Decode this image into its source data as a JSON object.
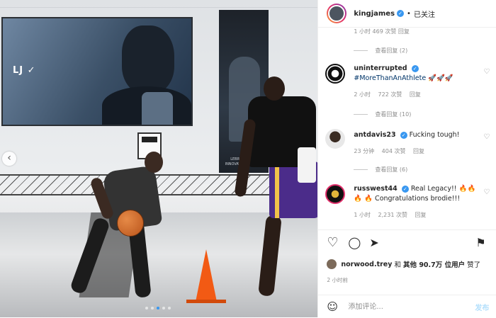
{
  "post_header": {
    "username": "kingjames",
    "verified_glyph": "✓",
    "separator": "•",
    "follow_label": "已关注"
  },
  "photo_overlay": {
    "screen_logo": "LJ  ✓",
    "banner_caption": "LEBRON JAMES INNOVATION CENTER",
    "carousel_prev": "‹"
  },
  "comments": {
    "cut_meta": "1 小时   469 次赞   回复",
    "thread_1_replies": "查看回复 (2)",
    "items": [
      {
        "username": "uninterrupted",
        "verified": true,
        "text": "#MoreThanAnAthlete 🚀🚀🚀",
        "time": "2 小时",
        "likes": "722 次赞",
        "reply": "回复",
        "view_replies": "查看回复 (10)"
      },
      {
        "username": "antdavis23",
        "verified": true,
        "text": "Fucking tough!",
        "time": "23 分钟",
        "likes": "404 次赞",
        "reply": "回复",
        "view_replies": "查看回复 (6)"
      },
      {
        "username": "russwest44",
        "verified": true,
        "text": "Real Legacy!! 🔥🔥🔥 🔥 Congratulations brodie!!!",
        "time": "1 小时",
        "likes": "2,231 次赞",
        "reply": "回复"
      }
    ]
  },
  "actions": {
    "like_icon": "♡",
    "comment_icon": "◯",
    "share_icon": "➤",
    "save_icon": "⚑"
  },
  "likes_line": {
    "user": "norwood.trey",
    "and": "和",
    "others": "其他 90.7万 位用户",
    "suffix": "赞了"
  },
  "time_ago": "2 小时前",
  "add_comment": {
    "emoji_icon": "☺",
    "placeholder": "添加评论...",
    "post_label": "发布"
  },
  "colors": {
    "accent": "#3897f0",
    "muted": "#8e8e8e",
    "text": "#262626",
    "post_disabled": "#b2dffc"
  }
}
